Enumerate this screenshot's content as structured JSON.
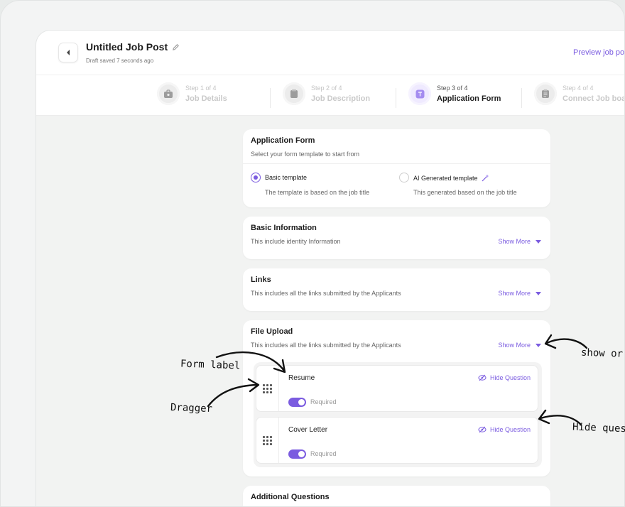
{
  "header": {
    "title": "Untitled Job Post",
    "draft_status": "Draft saved 7 seconds ago",
    "preview_link": "Preview job po"
  },
  "steps": [
    {
      "number": "Step 1 of 4",
      "label": "Job Details",
      "icon": "briefcase-icon",
      "active": false
    },
    {
      "number": "Step 2 of 4",
      "label": "Job Description",
      "icon": "document-icon",
      "active": false
    },
    {
      "number": "Step 3 of 4",
      "label": "Application Form",
      "icon": "form-icon",
      "active": true
    },
    {
      "number": "Step 4 of 4",
      "label": "Connect Job boa",
      "icon": "clipboard-icon",
      "active": false
    }
  ],
  "application_form": {
    "title": "Application Form",
    "desc": "Select your form template to start from",
    "options": [
      {
        "label": "Basic template",
        "desc": "The template is based on the job title",
        "selected": true
      },
      {
        "label": "AI Generated template",
        "desc": "This generated based on the job title",
        "selected": false
      }
    ]
  },
  "sections": {
    "basic": {
      "title": "Basic Information",
      "desc": "This include identity Information",
      "show_more": "Show More"
    },
    "links": {
      "title": "Links",
      "desc": "This includes all the links submitted by the Applicants",
      "show_more": "Show More"
    },
    "file_upload": {
      "title": "File Upload",
      "desc": "This includes all the links submitted by the Applicants",
      "show_more": "Show More"
    },
    "additional": {
      "title": "Additional Questions"
    }
  },
  "questions": [
    {
      "label": "Resume",
      "hide": "Hide Question",
      "required": "Required",
      "required_on": true
    },
    {
      "label": "Cover Letter",
      "hide": "Hide Question",
      "required": "Required",
      "required_on": true
    }
  ],
  "annotations": {
    "form_label": "Form label",
    "dragger": "Dragger",
    "show_or": "show or l",
    "hide_quest": "Hide quest"
  },
  "colors": {
    "accent": "#7b5ce0",
    "background": "#f2f3f2"
  }
}
